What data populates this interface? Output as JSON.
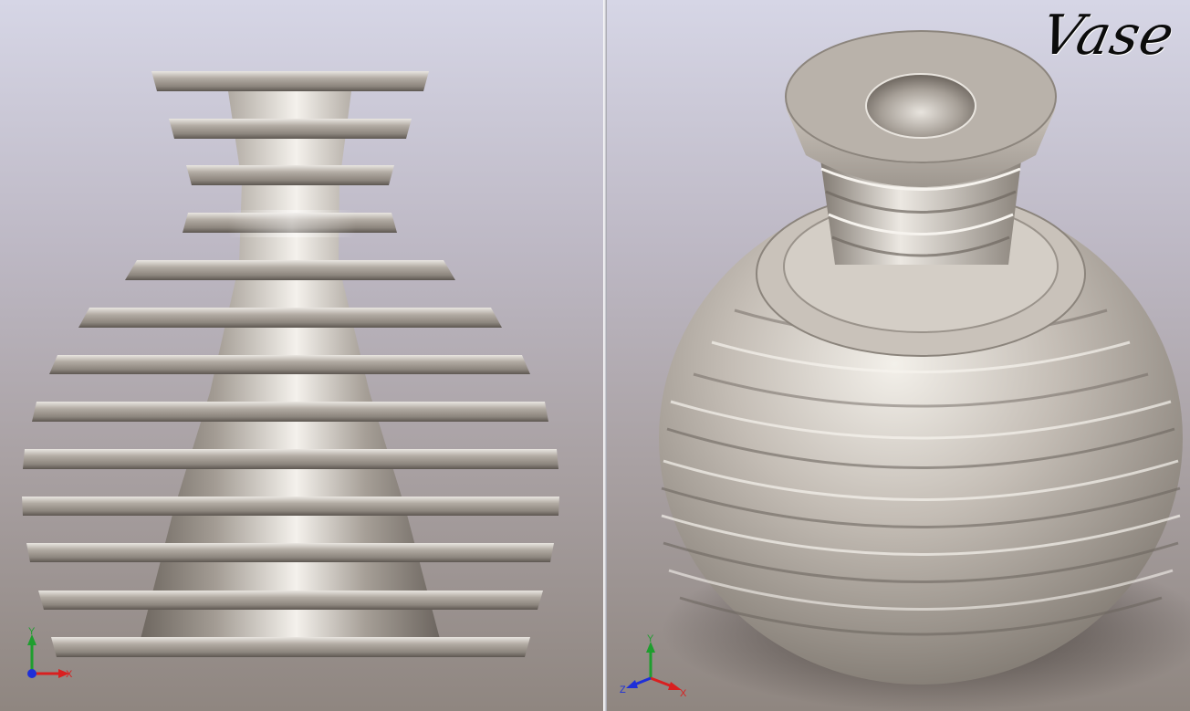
{
  "app": {
    "title": "Vase"
  },
  "left_view": {
    "name": "front-view",
    "axes": {
      "x": "X",
      "y": "Y"
    }
  },
  "right_view": {
    "name": "isometric-view",
    "axes": {
      "x": "X",
      "y": "Y",
      "z": "Z"
    }
  },
  "colors": {
    "background_top": "#d6d6e6",
    "background_bottom": "#8f8680",
    "model": "#b5aea6",
    "x_axis": "#d92020",
    "y_axis": "#1e9e2e",
    "z_axis": "#1e2fd9"
  }
}
